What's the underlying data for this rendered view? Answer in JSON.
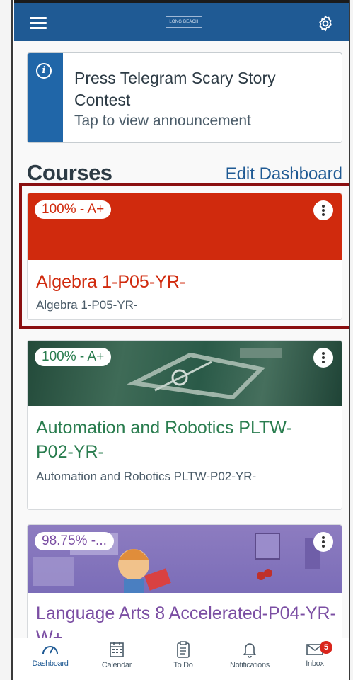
{
  "topbar": {
    "logo_text": "LONG BEACH",
    "brand_color": "#1f5a94"
  },
  "announcement": {
    "title": "Press Telegram Scary Story Contest",
    "subtitle": "Tap to view announcement",
    "icon": "info-icon"
  },
  "courses": {
    "heading": "Courses",
    "edit_label": "Edit Dashboard",
    "items": [
      {
        "grade": "100% - A+",
        "title": "Algebra 1-P05-YR-",
        "subtitle": "Algebra 1-P05-YR-",
        "color": "#d02a0d"
      },
      {
        "grade": "100% - A+",
        "title": "Automation and Robotics PLTW-P02-YR-",
        "subtitle": "Automation and Robotics PLTW-P02-YR-",
        "color": "#2a7d4f"
      },
      {
        "grade": "98.75% -...",
        "title": "Language Arts 8 Accelerated-P04-YR-W+",
        "subtitle": "",
        "color": "#7b4ea3"
      }
    ]
  },
  "tabbar": {
    "tabs": [
      {
        "label": "Dashboard",
        "icon": "dashboard-icon"
      },
      {
        "label": "Calendar",
        "icon": "calendar-icon"
      },
      {
        "label": "To Do",
        "icon": "todo-icon"
      },
      {
        "label": "Notifications",
        "icon": "bell-icon"
      },
      {
        "label": "Inbox",
        "icon": "mail-icon",
        "badge": "5"
      }
    ]
  }
}
